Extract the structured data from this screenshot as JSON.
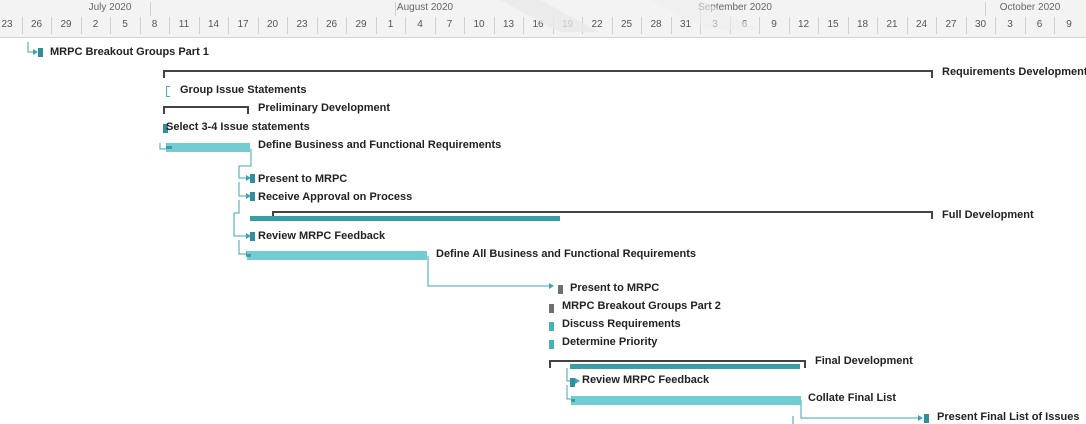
{
  "timescale": {
    "months": [
      "July 2020",
      "August 2020",
      "September 2020",
      "October 2020"
    ],
    "days": [
      "23",
      "26",
      "29",
      "2",
      "5",
      "8",
      "11",
      "14",
      "17",
      "20",
      "23",
      "26",
      "29",
      "1",
      "4",
      "7",
      "10",
      "13",
      "16",
      "19",
      "22",
      "25",
      "28",
      "31",
      "3",
      "6",
      "9",
      "12",
      "15",
      "18",
      "21",
      "24",
      "27",
      "30",
      "3",
      "6",
      "9"
    ]
  },
  "tasks": {
    "t1": "MRPC Breakout Groups Part 1",
    "t2": "Requirements Development",
    "t3": "Group Issue Statements",
    "t4": "Preliminary Development",
    "t5": "Select 3-4 Issue statements",
    "t6": "Define Business and Functional Requirements",
    "t7": "Present to MRPC",
    "t8": "Receive Approval on Process",
    "t9": "Full Development",
    "t10": "Review MRPC Feedback",
    "t11": "Define All Business and Functional Requirements",
    "t12": "Present to MRPC",
    "t13": "MRPC Breakout Groups Part 2",
    "t14": "Discuss Requirements",
    "t15": "Determine Priority",
    "t16": "Final Development",
    "t17": "Review MRPC Feedback",
    "t18": "Collate Final List",
    "t19": "Present Final List of Issues"
  },
  "colors": {
    "bar": "#72ccd3",
    "bar_progress": "#3a9ea7",
    "summary": "#444444",
    "link": "#3aa7b3"
  }
}
